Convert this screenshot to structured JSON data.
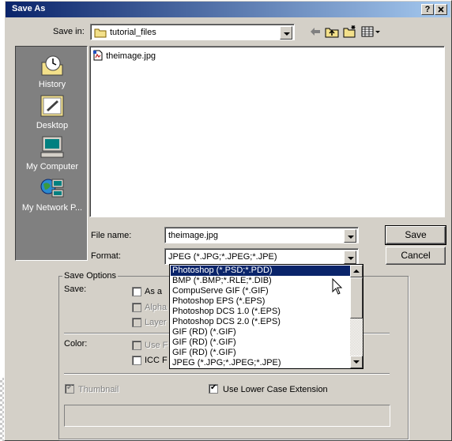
{
  "window": {
    "title": "Save As",
    "help_button": "?",
    "close_button": "X"
  },
  "save_in": {
    "label": "Save in:",
    "value": "tutorial_files"
  },
  "toolbar": {
    "icons": [
      "back-arrow-icon",
      "up-folder-icon",
      "new-folder-icon",
      "view-menu-icon"
    ]
  },
  "places": [
    {
      "label": "History",
      "icon": "history-icon"
    },
    {
      "label": "Desktop",
      "icon": "desktop-icon"
    },
    {
      "label": "My Computer",
      "icon": "my-computer-icon"
    },
    {
      "label": "My Network P...",
      "icon": "network-places-icon"
    }
  ],
  "files": [
    {
      "name": "theimage.jpg",
      "icon": "image-file-icon"
    }
  ],
  "file_name": {
    "label": "File name:",
    "value": "theimage.jpg"
  },
  "format": {
    "label": "Format:",
    "value": "JPEG (*.JPG;*.JPEG;*.JPE)"
  },
  "buttons": {
    "save": "Save",
    "cancel": "Cancel"
  },
  "save_options": {
    "title": "Save Options",
    "save_label": "Save:",
    "as_a_copy": "As a",
    "alpha": "Alpha",
    "layers": "Layer",
    "color_label": "Color:",
    "use_proof": "Use F",
    "icc_profile": "ICC F",
    "thumbnail": "Thumbnail",
    "use_lower_case": "Use Lower Case Extension"
  },
  "format_options": [
    "Photoshop (*.PSD;*.PDD)",
    "BMP (*.BMP;*.RLE;*.DIB)",
    "CompuServe GIF (*.GIF)",
    "Photoshop EPS (*.EPS)",
    "Photoshop DCS 1.0 (*.EPS)",
    "Photoshop DCS 2.0 (*.EPS)",
    "GIF (RD) (*.GIF)",
    "GIF (RD) (*.GIF)",
    "GIF (RD) (*.GIF)",
    "JPEG (*.JPG;*.JPEG;*.JPE)"
  ],
  "selected_format_index": 0,
  "colors": {
    "title_start": "#0a246a",
    "title_end": "#a6caf0",
    "face": "#d4d0c8",
    "places_bg": "#808080",
    "selection": "#0a246a"
  }
}
